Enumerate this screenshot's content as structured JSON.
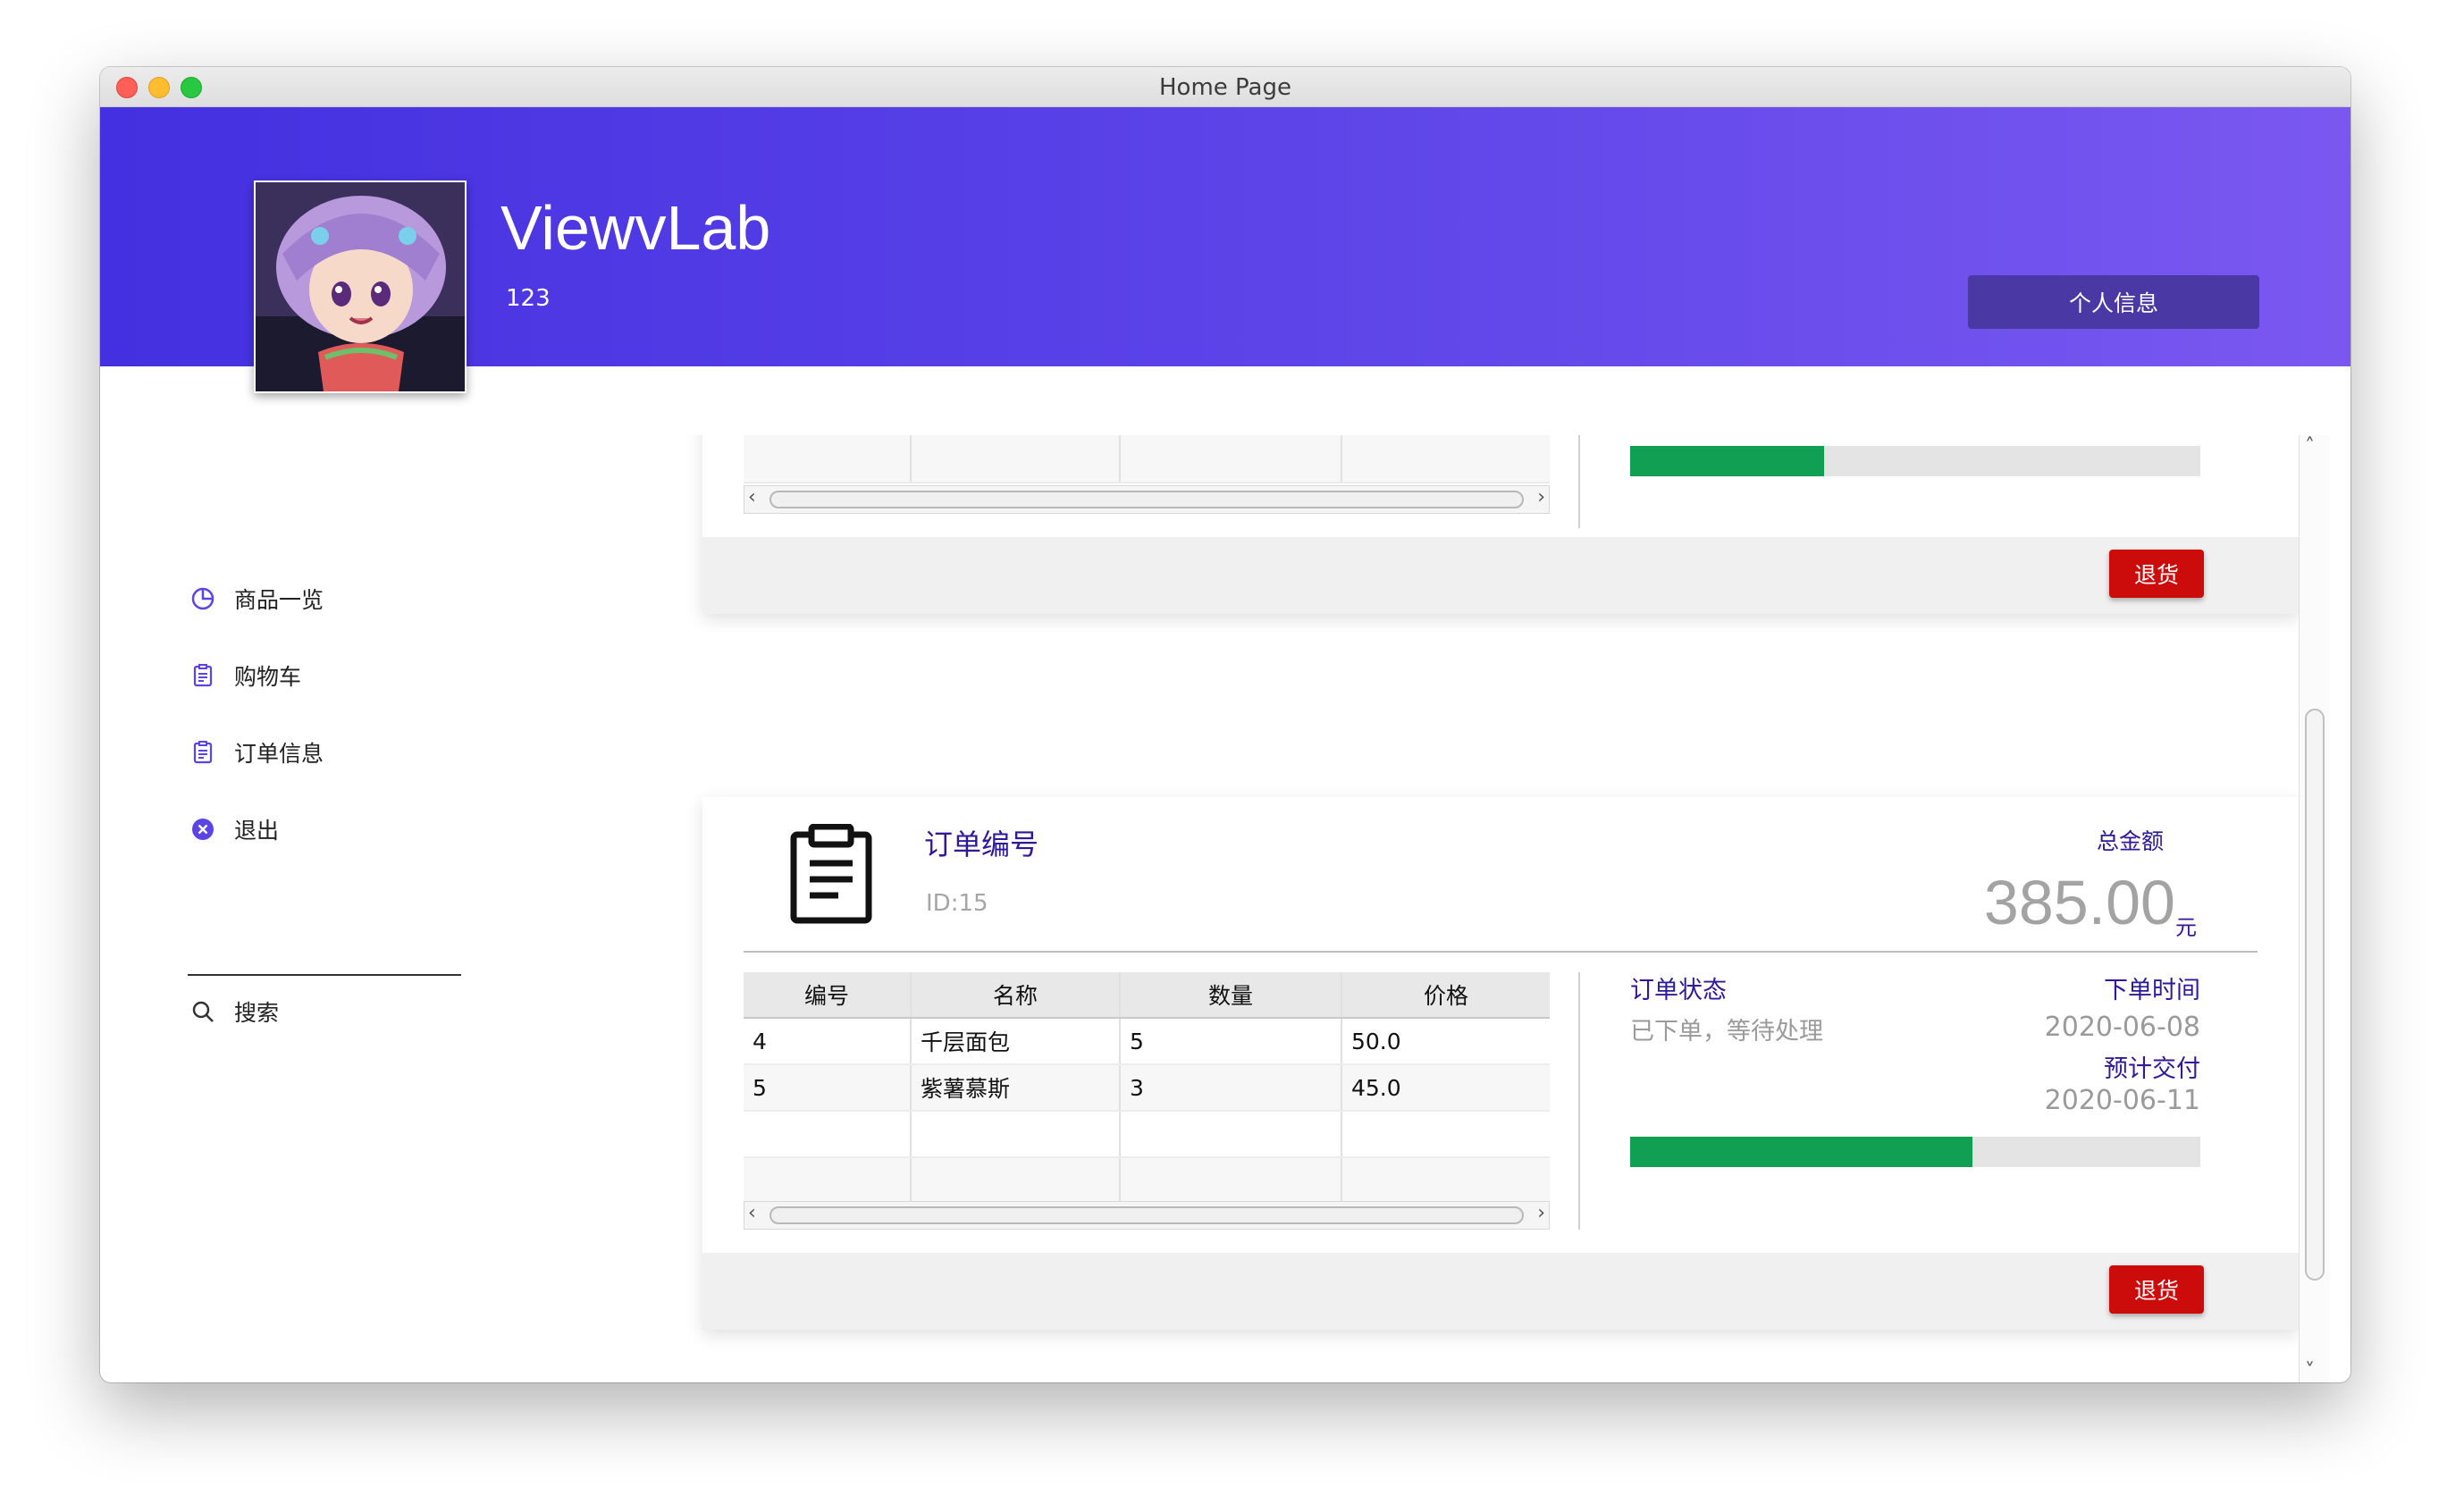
{
  "window": {
    "title": "Home Page"
  },
  "header": {
    "app_name": "ViewvLab",
    "user_id": "123",
    "profile_button": "个人信息",
    "gradient_colors": [
      "#4430e0",
      "#7a58f0"
    ]
  },
  "sidebar": {
    "items": [
      {
        "label": "商品一览",
        "icon": "pie-chart-icon"
      },
      {
        "label": "购物车",
        "icon": "document-icon"
      },
      {
        "label": "订单信息",
        "icon": "document-icon"
      },
      {
        "label": "退出",
        "icon": "close-circle-icon"
      }
    ],
    "search_label": "搜索",
    "search_icon": "search-icon"
  },
  "orders": [
    {
      "progress_fraction": 0.34,
      "return_button": "退货"
    },
    {
      "title": "订单编号",
      "id": "ID:15",
      "total_label": "总金额",
      "total_amount": "385.00",
      "currency": "元",
      "table": {
        "headers": [
          "编号",
          "名称",
          "数量",
          "价格"
        ],
        "rows": [
          [
            "4",
            "千层面包",
            "5",
            "50.0"
          ],
          [
            "5",
            "紫薯慕斯",
            "3",
            "45.0"
          ]
        ]
      },
      "status_label": "订单状态",
      "status_value": "已下单，等待处理",
      "order_time_label": "下单时间",
      "order_time": "2020-06-08",
      "delivery_label": "预计交付",
      "delivery_time": "2020-06-11",
      "progress_fraction": 0.6,
      "return_button": "退货"
    }
  ],
  "colors": {
    "accent": "#2c1a9a",
    "progress": "#11a053",
    "danger": "#cc0b0b"
  }
}
